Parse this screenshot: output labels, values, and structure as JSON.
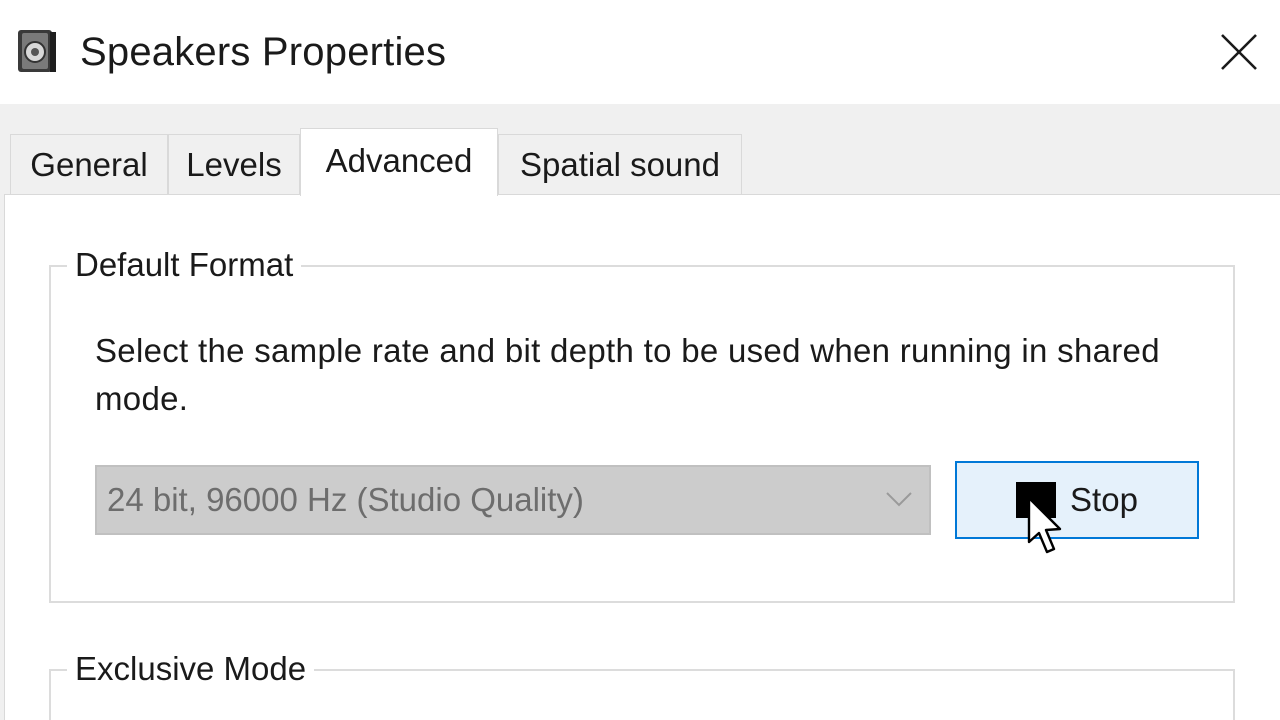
{
  "window": {
    "title": "Speakers Properties",
    "icon": "speaker-icon",
    "close_icon": "close-icon"
  },
  "tabs": [
    {
      "label": "General",
      "active": false
    },
    {
      "label": "Levels",
      "active": false
    },
    {
      "label": "Advanced",
      "active": true
    },
    {
      "label": "Spatial sound",
      "active": false
    }
  ],
  "default_format": {
    "legend": "Default Format",
    "description": "Select the sample rate and bit depth to be used when running in shared mode.",
    "selected_format": "24 bit, 96000 Hz (Studio Quality)",
    "select_disabled": true,
    "test_button_label": "Stop",
    "test_button_icon": "stop-icon"
  },
  "exclusive_mode": {
    "legend": "Exclusive Mode"
  },
  "colors": {
    "accent_border": "#0078d7",
    "button_bg": "#e5f1fb",
    "disabled_select_bg": "#cccccc",
    "disabled_text": "#6d6d6d"
  }
}
